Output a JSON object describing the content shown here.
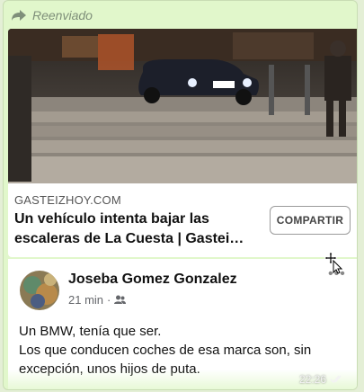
{
  "message": {
    "forwarded_label": "Reenviado",
    "forward_icon": "forward-arrow-icon",
    "time": "22:26",
    "status_icon": "double-check-icon"
  },
  "link_preview": {
    "domain": "GASTEIZHOY.COM",
    "title": "Un vehículo intenta bajar las escaleras de La Cuesta | Gastei…",
    "share_label": "COMPARTIR"
  },
  "post": {
    "author": "Joseba Gomez Gonzalez",
    "time": "21 min",
    "separator": "·",
    "audience_icon": "friends-icon",
    "more_icon": "more-options-icon",
    "text": "Un BMW, tenía que ser.\n Los que conducen coches de esa marca son, sin excepción, unos hijos de puta."
  },
  "colors": {
    "bubble_bg": "#e1f7cb",
    "forwarded_text": "#7f8f7a"
  }
}
